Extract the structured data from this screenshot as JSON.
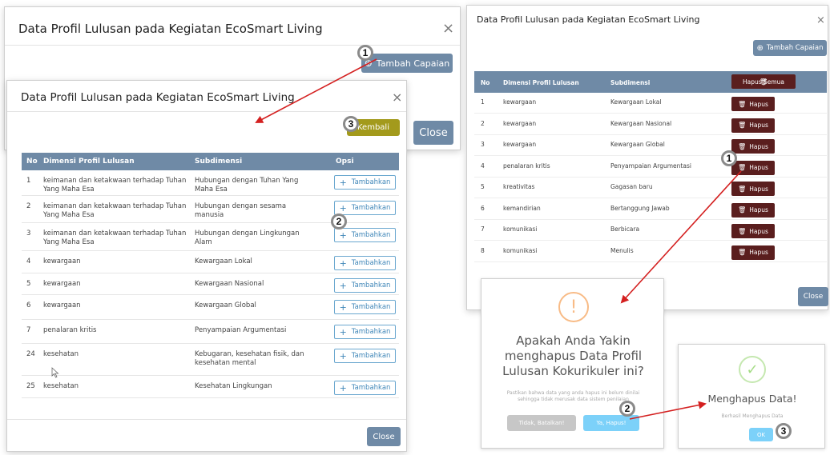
{
  "outer_modal": {
    "title": "Data Profil Lulusan pada Kegiatan EcoSmart Living",
    "add_button": "Tambah Capaian",
    "close_button": "Close"
  },
  "left_modal": {
    "title": "Data Profil Lulusan pada Kegiatan EcoSmart Living",
    "back_button": "Kembali",
    "columns": [
      "No",
      "Dimensi Profil Lulusan",
      "Subdimensi",
      "Opsi"
    ],
    "rows": [
      {
        "no": "1",
        "dimensi": "keimanan dan ketakwaan terhadap Tuhan Yang Maha Esa",
        "sub": "Hubungan dengan Tuhan Yang Maha Esa",
        "action": "Tambahkan"
      },
      {
        "no": "2",
        "dimensi": "keimanan dan ketakwaan terhadap Tuhan Yang Maha Esa",
        "sub": "Hubungan dengan sesama manusia",
        "action": "Tambahkan"
      },
      {
        "no": "3",
        "dimensi": "keimanan dan ketakwaan terhadap Tuhan Yang Maha Esa",
        "sub": "Hubungan dengan Lingkungan Alam",
        "action": "Tambahkan"
      },
      {
        "no": "4",
        "dimensi": "kewargaan",
        "sub": "Kewargaan Lokal",
        "action": "Tambahkan"
      },
      {
        "no": "5",
        "dimensi": "kewargaan",
        "sub": "Kewargaan Nasional",
        "action": "Tambahkan"
      },
      {
        "no": "6",
        "dimensi": "kewargaan",
        "sub": "Kewargaan Global",
        "action": "Tambahkan"
      },
      {
        "no": "7",
        "dimensi": "penalaran kritis",
        "sub": "Penyampaian Argumentasi",
        "action": "Tambahkan"
      },
      {
        "no": "24",
        "dimensi": "kesehatan",
        "sub": "Kebugaran, kesehatan fisik, dan kesehatan mental",
        "action": "Tambahkan"
      },
      {
        "no": "25",
        "dimensi": "kesehatan",
        "sub": "Kesehatan Lingkungan",
        "action": "Tambahkan"
      }
    ],
    "close_button": "Close"
  },
  "right_modal": {
    "title": "Data Profil Lulusan pada Kegiatan EcoSmart Living",
    "add_button": "Tambah Capaian",
    "columns": [
      "No",
      "Dimensi Profil Lulusan",
      "Subdimensi"
    ],
    "delete_all_button": "Hapus Semua",
    "rows": [
      {
        "no": "1",
        "dimensi": "kewargaan",
        "sub": "Kewargaan Lokal",
        "action": "Hapus"
      },
      {
        "no": "2",
        "dimensi": "kewargaan",
        "sub": "Kewargaan Nasional",
        "action": "Hapus"
      },
      {
        "no": "3",
        "dimensi": "kewargaan",
        "sub": "Kewargaan Global",
        "action": "Hapus"
      },
      {
        "no": "4",
        "dimensi": "penalaran kritis",
        "sub": "Penyampaian Argumentasi",
        "action": "Hapus"
      },
      {
        "no": "5",
        "dimensi": "kreativitas",
        "sub": "Gagasan baru",
        "action": "Hapus"
      },
      {
        "no": "6",
        "dimensi": "kemandirian",
        "sub": "Bertanggung Jawab",
        "action": "Hapus"
      },
      {
        "no": "7",
        "dimensi": "komunikasi",
        "sub": "Berbicara",
        "action": "Hapus"
      },
      {
        "no": "8",
        "dimensi": "komunikasi",
        "sub": "Menulis",
        "action": "Hapus"
      }
    ],
    "close_button": "Close"
  },
  "confirm_dialog": {
    "icon_symbol": "!",
    "title": "Apakah Anda Yakin menghapus Data Profil Lulusan Kokurikuler ini?",
    "message": "Pastikan bahwa data yang anda hapus ini belum dinilai sehingga tidak merusak data sistem penilaian",
    "cancel_button": "Tidak, Batalkan!",
    "confirm_button": "Ya, Hapus!"
  },
  "success_dialog": {
    "icon_symbol": "✓",
    "title": "Menghapus Data!",
    "message": "Berhasil Menghapus Data",
    "ok_button": "OK"
  },
  "step_badges": [
    "1",
    "2",
    "3",
    "1",
    "2",
    "3"
  ],
  "colors": {
    "header_steel": "#6f8aa6",
    "maroon": "#5a1e1e",
    "olive": "#a39a1c",
    "outline_blue": "#6aa7cf",
    "arrow_red": "#d42020",
    "warning_orange": "#f8bb86",
    "success_green": "#a5dc86",
    "confirm_blue": "#7cd1f9"
  }
}
